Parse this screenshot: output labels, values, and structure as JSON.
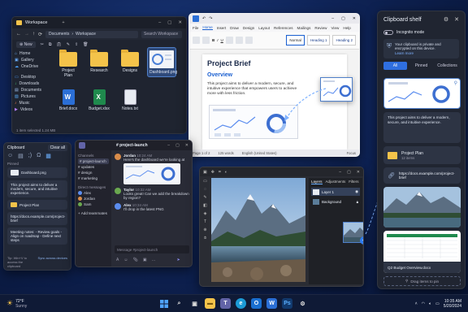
{
  "explorer": {
    "title": "Workspace",
    "breadcrumb": [
      "Documents",
      "Workspace"
    ],
    "search_placeholder": "Search Workspace",
    "new_label": "New",
    "sidebar": [
      "Home",
      "Gallery",
      "OneDrive",
      "Desktop",
      "Downloads",
      "Documents",
      "Pictures",
      "Music",
      "Videos"
    ],
    "files": [
      {
        "name": "Project Plan",
        "kind": "folder"
      },
      {
        "name": "Research",
        "kind": "folder"
      },
      {
        "name": "Designs",
        "kind": "folder"
      },
      {
        "name": "Dashboard.png",
        "kind": "image"
      },
      {
        "name": "Brief.docx",
        "kind": "word"
      },
      {
        "name": "Budget.xlsx",
        "kind": "excel"
      },
      {
        "name": "Notes.txt",
        "kind": "text"
      }
    ],
    "status": "1 item selected  1.24 MB"
  },
  "word": {
    "menu": [
      "File",
      "Home",
      "Insert",
      "Draw",
      "Design",
      "Layout",
      "References",
      "Mailings",
      "Review",
      "View",
      "Help"
    ],
    "styles": [
      "Normal",
      "Heading 1",
      "Heading 2"
    ],
    "doc_title": "Project Brief",
    "overview_heading": "Overview",
    "body_text": "This project aims to deliver a modern, secure, and intuitive experience that empowers users to achieve more with less friction.",
    "status": [
      "Page 1 of 2",
      "125 words",
      "English (United States)",
      "Focus"
    ]
  },
  "clip_small": {
    "title": "Clipboard",
    "clear_label": "Clear all",
    "pinned_label": "Pinned",
    "items": [
      "Dashboard.png",
      "This project aims to deliver a modern, secure, and intuitive experience.",
      "Project Plan",
      "https://docs.example.com/project-brief",
      "Meeting notes: - Review goals - Align on roadmap - Define next steps"
    ],
    "footer": "Tip: Win+V to access the clipboard",
    "footer_link": "Sync across devices"
  },
  "teams": {
    "channel": "# project-launch",
    "sidebar_title": "Channels",
    "channels": [
      "# project-launch",
      "# updates",
      "# design",
      "# marketing"
    ],
    "dm_title": "Direct messages",
    "dms": [
      "Alex",
      "Jordan",
      "Sam"
    ],
    "add_label": "+ Add teammates",
    "messages": [
      {
        "name": "Jordan",
        "time": "10:24 AM",
        "text": "Here's the dashboard we're looking at",
        "color": "#d98c4a"
      },
      {
        "name": "Taylor",
        "time": "10:32 AM",
        "text": "Looks great! Can we add the breakdown by region?",
        "color": "#6aa84f"
      },
      {
        "name": "Alex",
        "time": "10:34 AM",
        "text": "I'll drop in the latest PNG",
        "color": "#5b8def"
      }
    ],
    "compose_placeholder": "Message #project-launch"
  },
  "photo": {
    "tabs": [
      "Layers",
      "Adjustments",
      "Filters"
    ],
    "layers": [
      "Layer 1",
      "Background"
    ]
  },
  "shelf": {
    "title": "Clipboard shelf",
    "incognito_label": "Incognito mode",
    "notice": "Your clipboard is private and encrypted on this device.",
    "learn_more": "Learn more",
    "tabs": [
      "All",
      "Pinned",
      "Collections"
    ],
    "text_item": "This project aims to deliver a modern, secure, and intuitive experience.",
    "folder_name": "Project Plan",
    "folder_meta": "12 items",
    "link_url": "https://docs.example.com/project-brief",
    "spreadsheet_name": "Q2 Budget Overview.docx",
    "drop_label": "Drag items to pin"
  },
  "taskbar": {
    "weather_temp": "72°F",
    "weather_desc": "Sunny",
    "time": "10:35 AM",
    "date": "5/20/2024"
  }
}
